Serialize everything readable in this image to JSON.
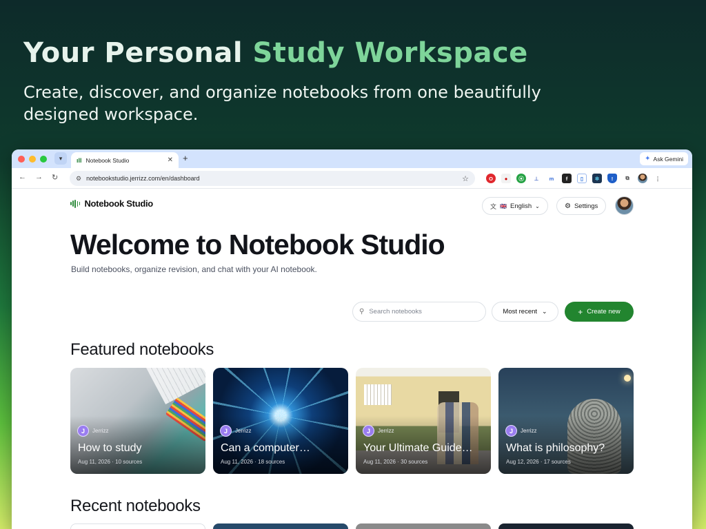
{
  "hero": {
    "title_part1": "Your Personal ",
    "title_part2": "Study Workspace",
    "subtitle": "Create, discover, and organize notebooks from one beautifully designed workspace."
  },
  "browser": {
    "tab_title": "Notebook Studio",
    "gemini_label": "Ask Gemini",
    "url": "notebookstudio.jerrizz.com/en/dashboard"
  },
  "app": {
    "logo_text": "Notebook Studio",
    "language_label": "English",
    "settings_label": "Settings",
    "welcome_title": "Welcome to Notebook Studio",
    "welcome_subtitle": "Build notebooks, organize revision, and chat with your AI notebook.",
    "search_placeholder": "Search notebooks",
    "sort_label": "Most recent",
    "create_label": "Create new",
    "featured_title": "Featured notebooks",
    "recent_title": "Recent notebooks"
  },
  "featured": [
    {
      "avatar_letter": "J",
      "author": "Jerrizz",
      "title": "How to study",
      "date": "Aug 11, 2026",
      "sources": "10 sources"
    },
    {
      "avatar_letter": "J",
      "author": "Jerrizz",
      "title": "Can a computer…",
      "date": "Aug 11, 2026",
      "sources": "18 sources"
    },
    {
      "avatar_letter": "J",
      "author": "Jerrizz",
      "title": "Your Ultimate Guide…",
      "date": "Aug 11, 2026",
      "sources": "30 sources"
    },
    {
      "avatar_letter": "J",
      "author": "Jerrizz",
      "title": "What is philosophy?",
      "date": "Aug 12, 2026",
      "sources": "17 sources"
    }
  ],
  "colors": {
    "accent": "#22852f",
    "hero_accent": "#7ed59a"
  }
}
